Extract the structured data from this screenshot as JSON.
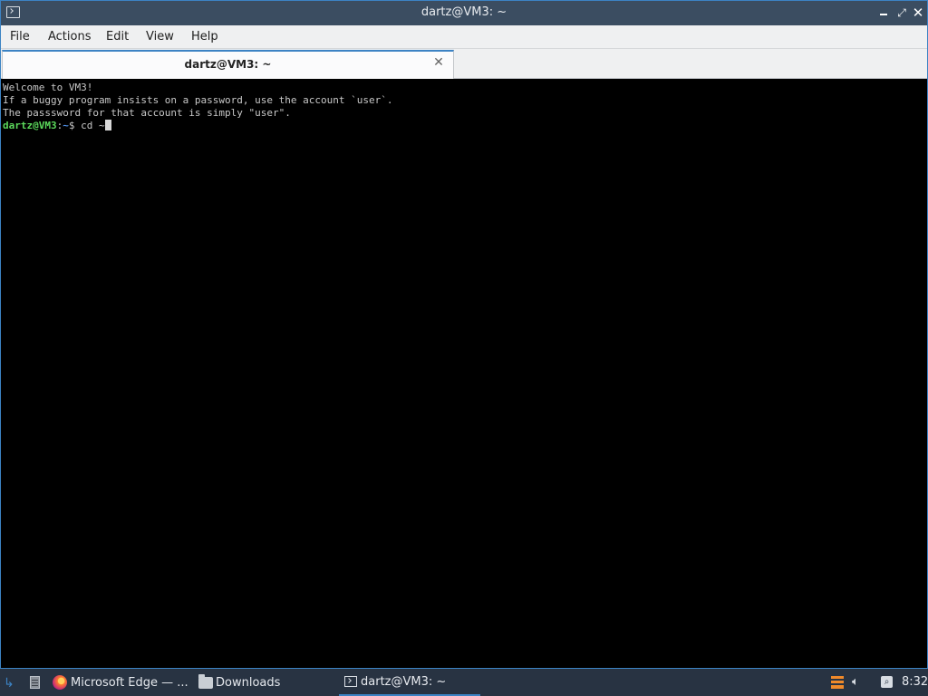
{
  "window": {
    "title": "dartz@VM3: ~",
    "icon": "terminal-icon"
  },
  "menubar": {
    "items": [
      "File",
      "Actions",
      "Edit",
      "View",
      "Help"
    ]
  },
  "tabs": [
    {
      "label": "dartz@VM3: ~",
      "close_icon": "close-icon"
    }
  ],
  "terminal": {
    "lines": [
      "Welcome to VM3!",
      "If a buggy program insists on a password, use the account `user`.",
      "The passsword for that account is simply \"user\"."
    ],
    "prompt": {
      "user_host": "dartz@VM3",
      "separator": ":",
      "path": "~",
      "symbol": "$ ",
      "command": "cd ~"
    }
  },
  "taskbar": {
    "items": [
      {
        "label": "Microsoft Edge — ...",
        "icon": "edge-icon"
      },
      {
        "label": "Downloads",
        "icon": "folder-icon"
      },
      {
        "label": "dartz@VM3: ~",
        "icon": "terminal-icon",
        "active": true
      }
    ],
    "clock": "8:32"
  },
  "colors": {
    "accent": "#3c83c4",
    "titlebar": "#3b4d61",
    "taskbar": "#283342",
    "terminal_bg": "#000000",
    "prompt_user": "#5bd85b",
    "prompt_path": "#4f8fe5"
  }
}
